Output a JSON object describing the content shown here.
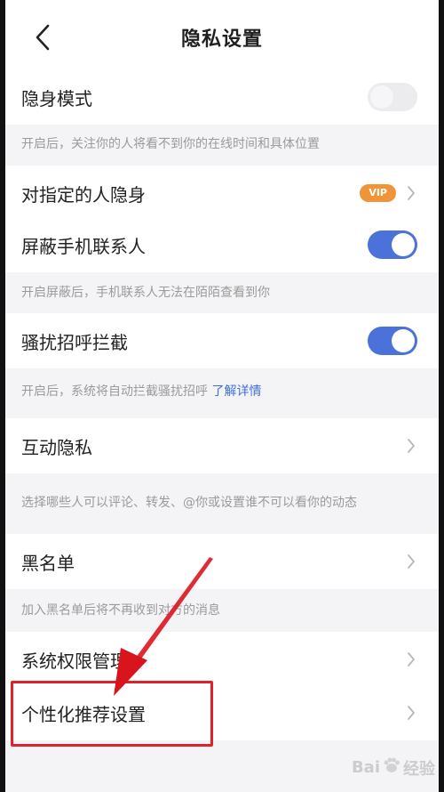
{
  "header": {
    "title": "隐私设置"
  },
  "rows": {
    "stealth": {
      "label": "隐身模式",
      "toggle": "off"
    },
    "stealth_desc": "开启后，关注你的人将看不到你的在线时间和具体位置",
    "hide_from": {
      "label": "对指定的人隐身",
      "badge": "VIP"
    },
    "block_contacts": {
      "label": "屏蔽手机联系人",
      "toggle": "on"
    },
    "block_contacts_desc": "开启屏蔽后，手机联系人无法在陌陌查看到你",
    "harass_block": {
      "label": "骚扰招呼拦截",
      "toggle": "on"
    },
    "harass_block_desc": "开启后，系统将自动拦截骚扰招呼",
    "harass_block_link": "了解详情",
    "interaction": {
      "label": "互动隐私"
    },
    "interaction_desc": "选择哪些人可以评论、转发、@你或设置谁不可以看你的动态",
    "blacklist": {
      "label": "黑名单"
    },
    "blacklist_desc": "加入黑名单后将不再收到对方的消息",
    "permissions": {
      "label": "系统权限管理"
    },
    "personalized": {
      "label": "个性化推荐设置"
    }
  },
  "watermark": {
    "text_left": "Bai",
    "text_right": "经验"
  },
  "colors": {
    "accent": "#4a72d8",
    "vip": "#f0943a",
    "highlight": "#e2202a"
  }
}
